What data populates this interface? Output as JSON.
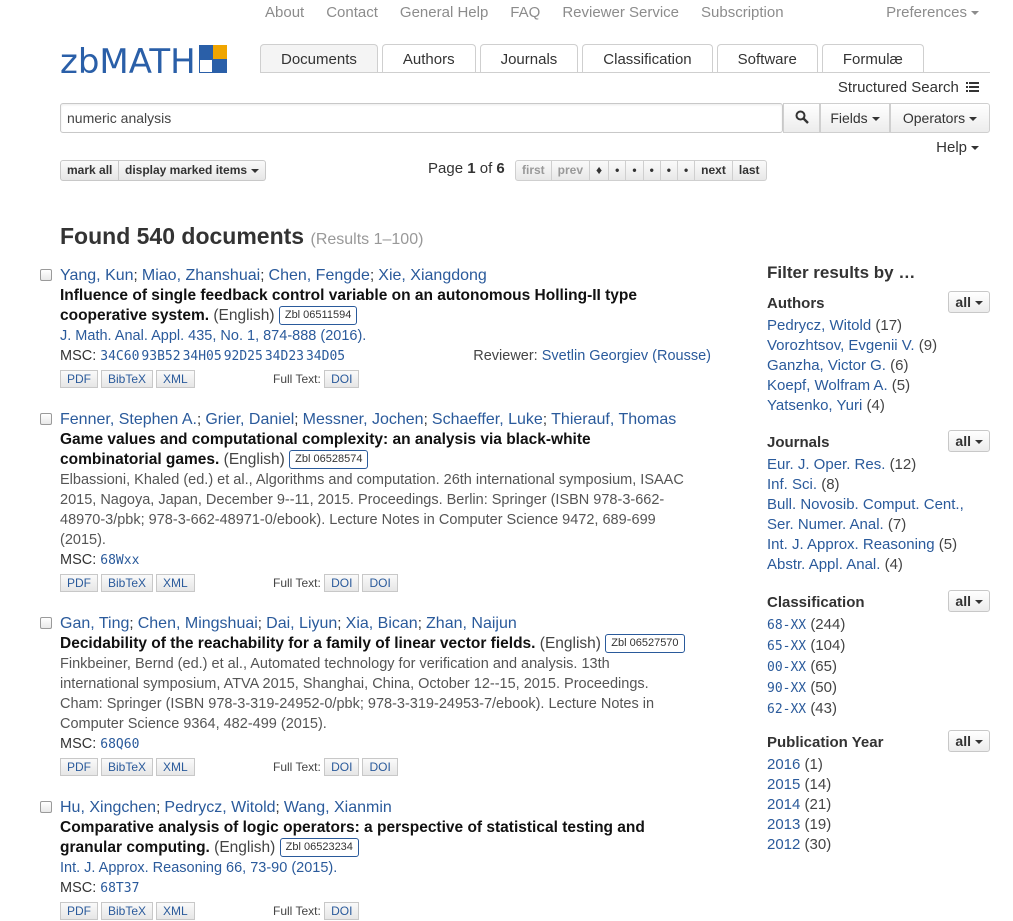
{
  "topnav": [
    "About",
    "Contact",
    "General Help",
    "FAQ",
    "Reviewer Service",
    "Subscription"
  ],
  "preferences": "Preferences",
  "logo_text": "zbMATH",
  "logo_colors": [
    "#2a5fa8",
    "#f0a500",
    "#ffffff",
    "#2a5fa8"
  ],
  "tabs": [
    "Documents",
    "Authors",
    "Journals",
    "Classification",
    "Software",
    "Formulæ"
  ],
  "structured_search": "Structured Search",
  "search": {
    "value": "numeric analysis",
    "fields": "Fields",
    "operators": "Operators"
  },
  "help": "Help",
  "mark_all": "mark all",
  "display_marked": "display marked items",
  "pagination": {
    "label": "Page",
    "current": "1",
    "of": "of",
    "total": "6",
    "items": [
      "first",
      "prev",
      "♦",
      "•",
      "•",
      "•",
      "•",
      "•",
      "next",
      "last"
    ]
  },
  "found": {
    "text": "Found 540 documents",
    "range": "(Results 1–100)"
  },
  "results": [
    {
      "authors": [
        "Yang, Kun",
        "Miao, Zhanshuai",
        "Chen, Fengde",
        "Xie, Xiangdong"
      ],
      "title_lines": [
        "Influence of single feedback control variable on an autonomous Holling-II type",
        "cooperative system."
      ],
      "lang": "(English)",
      "zbl": "Zbl 06511594",
      "source_lines": [
        "J. Math. Anal. Appl. 435, No. 1, 874-888 (2016)."
      ],
      "source_is_link": true,
      "msc_label": "MSC:",
      "msc": [
        "34C60",
        "93B52",
        "34H05",
        "92D25",
        "34D23",
        "34D05"
      ],
      "reviewer_label": "Reviewer:",
      "reviewer": "Svetlin Georgiev (Rousse)",
      "buttons": [
        "PDF",
        "BibTeX",
        "XML"
      ],
      "fulltext_label": "Full Text:",
      "fulltext": [
        "DOI"
      ]
    },
    {
      "authors": [
        "Fenner, Stephen A.",
        "Grier, Daniel",
        "Messner, Jochen",
        "Schaeffer, Luke",
        "Thierauf, Thomas"
      ],
      "title_lines": [
        "Game values and computational complexity: an analysis via black-white",
        "combinatorial games."
      ],
      "lang": "(English)",
      "zbl": "Zbl 06528574",
      "source_lines": [
        "Elbassioni, Khaled (ed.) et al., Algorithms and computation. 26th international symposium, ISAAC",
        "2015, Nagoya, Japan, December 9--11, 2015. Proceedings. Berlin: Springer (ISBN 978-3-662-",
        "48970-3/pbk; 978-3-662-48971-0/ebook). Lecture Notes in Computer Science 9472, 689-699",
        "(2015)."
      ],
      "source_is_link": false,
      "msc_label": "MSC:",
      "msc": [
        "68Wxx"
      ],
      "buttons": [
        "PDF",
        "BibTeX",
        "XML"
      ],
      "fulltext_label": "Full Text:",
      "fulltext": [
        "DOI",
        "DOI"
      ]
    },
    {
      "authors": [
        "Gan, Ting",
        "Chen, Mingshuai",
        "Dai, Liyun",
        "Xia, Bican",
        "Zhan, Naijun"
      ],
      "title_lines": [
        "Decidability of the reachability for a family of linear vector fields."
      ],
      "lang": "(English)",
      "zbl": "Zbl 06527570",
      "source_lines": [
        "Finkbeiner, Bernd (ed.) et al., Automated technology for verification and analysis. 13th",
        "international symposium, ATVA 2015, Shanghai, China, October 12--15, 2015. Proceedings.",
        "Cham: Springer (ISBN 978-3-319-24952-0/pbk; 978-3-319-24953-7/ebook). Lecture Notes in",
        "Computer Science 9364, 482-499 (2015)."
      ],
      "source_is_link": false,
      "msc_label": "MSC:",
      "msc": [
        "68Q60"
      ],
      "buttons": [
        "PDF",
        "BibTeX",
        "XML"
      ],
      "fulltext_label": "Full Text:",
      "fulltext": [
        "DOI",
        "DOI"
      ]
    },
    {
      "authors": [
        "Hu, Xingchen",
        "Pedrycz, Witold",
        "Wang, Xianmin"
      ],
      "title_lines": [
        "Comparative analysis of logic operators: a perspective of statistical testing and",
        "granular computing."
      ],
      "lang": "(English)",
      "zbl": "Zbl 06523234",
      "source_lines": [
        "Int. J. Approx. Reasoning 66, 73-90 (2015)."
      ],
      "source_is_link": true,
      "msc_label": "MSC:",
      "msc": [
        "68T37"
      ],
      "buttons": [
        "PDF",
        "BibTeX",
        "XML"
      ],
      "fulltext_label": "Full Text:",
      "fulltext": [
        "DOI"
      ]
    }
  ],
  "sidebar": {
    "title": "Filter results by …",
    "all_label": "all",
    "sections": [
      {
        "name": "Authors",
        "items": [
          {
            "label": "Pedrycz, Witold",
            "count": "(17)"
          },
          {
            "label": "Vorozhtsov, Evgenii V.",
            "count": "(9)"
          },
          {
            "label": "Ganzha, Victor G.",
            "count": "(6)"
          },
          {
            "label": "Koepf, Wolfram A.",
            "count": "(5)"
          },
          {
            "label": "Yatsenko, Yuri",
            "count": "(4)"
          }
        ]
      },
      {
        "name": "Journals",
        "items": [
          {
            "label": "Eur. J. Oper. Res.",
            "count": "(12)"
          },
          {
            "label": "Inf. Sci.",
            "count": "(8)"
          },
          {
            "label": "Bull. Novosib. Comput. Cent.,",
            "label2": "Ser. Numer. Anal.",
            "count": "(7)"
          },
          {
            "label": "Int. J. Approx. Reasoning",
            "count": "(5)"
          },
          {
            "label": "Abstr. Appl. Anal.",
            "count": "(4)"
          }
        ]
      },
      {
        "name": "Classification",
        "items": [
          {
            "label": "68-XX",
            "count": "(244)",
            "code": true
          },
          {
            "label": "65-XX",
            "count": "(104)",
            "code": true
          },
          {
            "label": "00-XX",
            "count": "(65)",
            "code": true
          },
          {
            "label": "90-XX",
            "count": "(50)",
            "code": true
          },
          {
            "label": "62-XX",
            "count": "(43)",
            "code": true
          }
        ]
      },
      {
        "name": "Publication Year",
        "items": [
          {
            "label": "2016",
            "count": "(1)"
          },
          {
            "label": "2015",
            "count": "(14)"
          },
          {
            "label": "2014",
            "count": "(21)"
          },
          {
            "label": "2013",
            "count": "(19)"
          },
          {
            "label": "2012",
            "count": "(30)"
          }
        ]
      }
    ]
  }
}
